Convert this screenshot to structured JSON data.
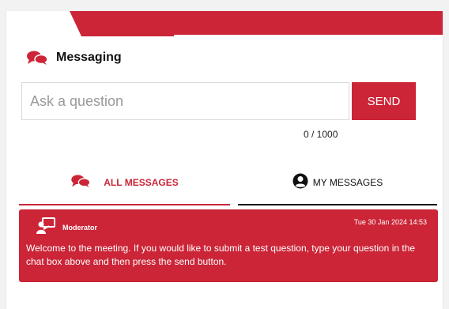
{
  "colors": {
    "accent": "#cb2537",
    "text_dark": "#111111",
    "background": "#f2f2f2"
  },
  "header": {
    "title": "Messaging",
    "icon": "chat-bubbles-icon"
  },
  "composer": {
    "placeholder": "Ask a question",
    "value": "",
    "send_label": "SEND",
    "counter": "0 / 1000"
  },
  "tabs": [
    {
      "label": "ALL MESSAGES",
      "icon": "chat-bubbles-icon",
      "active": true
    },
    {
      "label": "MY MESSAGES",
      "icon": "user-circle-icon",
      "active": false
    }
  ],
  "messages": [
    {
      "author": "Moderator",
      "author_icon": "presenter-icon",
      "timestamp": "Tue 30 Jan 2024 14:53",
      "text": "Welcome to the meeting. If you would like to submit a test question, type your question in the chat box above and then press the send button."
    }
  ]
}
